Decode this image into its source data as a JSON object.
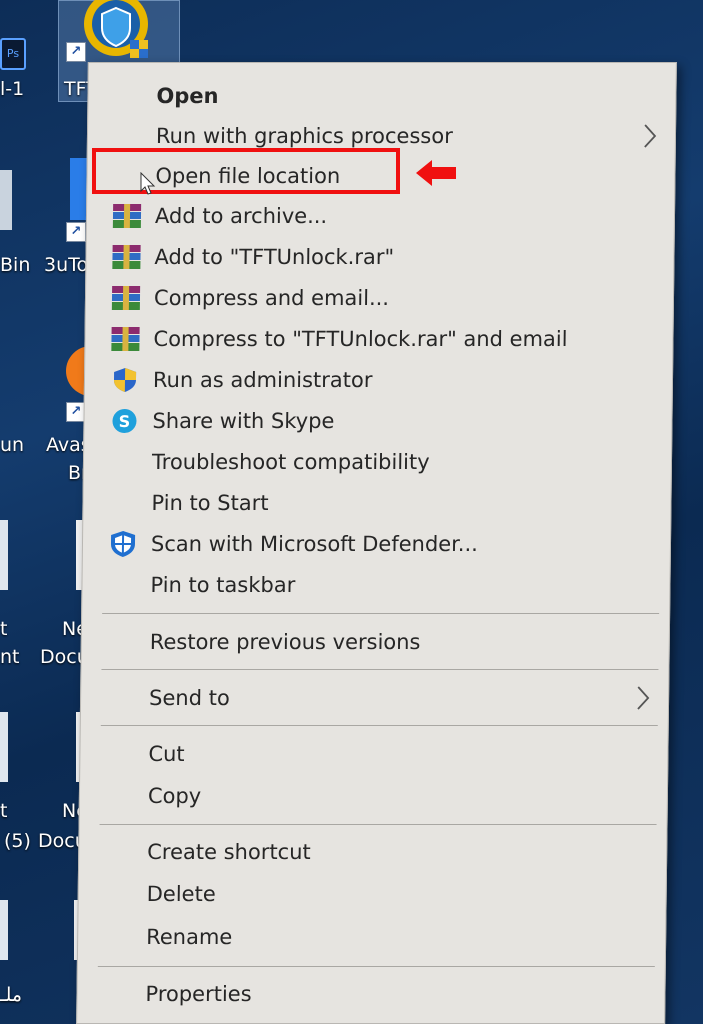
{
  "desktop": {
    "icons": [
      {
        "name": "ps-icon-label",
        "label": "Ps"
      },
      {
        "name": "label-1-1",
        "label": "l-1"
      },
      {
        "name": "tft-label",
        "label": "TFT"
      },
      {
        "name": "bin-label",
        "label": "Bin"
      },
      {
        "name": "3uto-label",
        "label": "3uTo"
      },
      {
        "name": "un-label",
        "label": "un"
      },
      {
        "name": "avas-label",
        "label": "Avas"
      },
      {
        "name": "br-label",
        "label": "Br"
      },
      {
        "name": "t-label",
        "label": "t"
      },
      {
        "name": "ne-label",
        "label": "Ne"
      },
      {
        "name": "nt-label",
        "label": "nt"
      },
      {
        "name": "docu-label",
        "label": "Docu"
      },
      {
        "name": "t2-label",
        "label": "t"
      },
      {
        "name": "ne2-label",
        "label": "Ne"
      },
      {
        "name": "5-label",
        "label": "(5)"
      },
      {
        "name": "docu2-label",
        "label": "Docu"
      },
      {
        "name": "arabic-label",
        "label": "ملـ"
      }
    ]
  },
  "menu": {
    "items": [
      {
        "label": "Open",
        "bold": true
      },
      {
        "label": "Run with graphics processor",
        "submenu": true
      },
      {
        "label": "Open file location"
      },
      {
        "label": "Add to archive...",
        "icon": "winrar-icon"
      },
      {
        "label": "Add to \"TFTUnlock.rar\"",
        "icon": "winrar-icon"
      },
      {
        "label": "Compress and email...",
        "icon": "winrar-icon"
      },
      {
        "label": "Compress to \"TFTUnlock.rar\" and email",
        "icon": "winrar-icon"
      },
      {
        "label": "Run as administrator",
        "icon": "uac-shield-icon"
      },
      {
        "label": "Share with Skype",
        "icon": "skype-icon"
      },
      {
        "label": "Troubleshoot compatibility"
      },
      {
        "label": "Pin to Start"
      },
      {
        "label": "Scan with Microsoft Defender...",
        "icon": "defender-icon"
      },
      {
        "label": "Pin to taskbar"
      },
      {
        "label": "Restore previous versions"
      },
      {
        "label": "Send to",
        "submenu": true
      },
      {
        "label": "Cut"
      },
      {
        "label": "Copy"
      },
      {
        "label": "Create shortcut"
      },
      {
        "label": "Delete"
      },
      {
        "label": "Rename"
      },
      {
        "label": "Properties"
      }
    ],
    "highlighted_item": "Open file location"
  },
  "colors": {
    "highlight_box": "#f01010",
    "menu_bg": "#e6e4e0",
    "desktop_bg": "#143c6e"
  }
}
